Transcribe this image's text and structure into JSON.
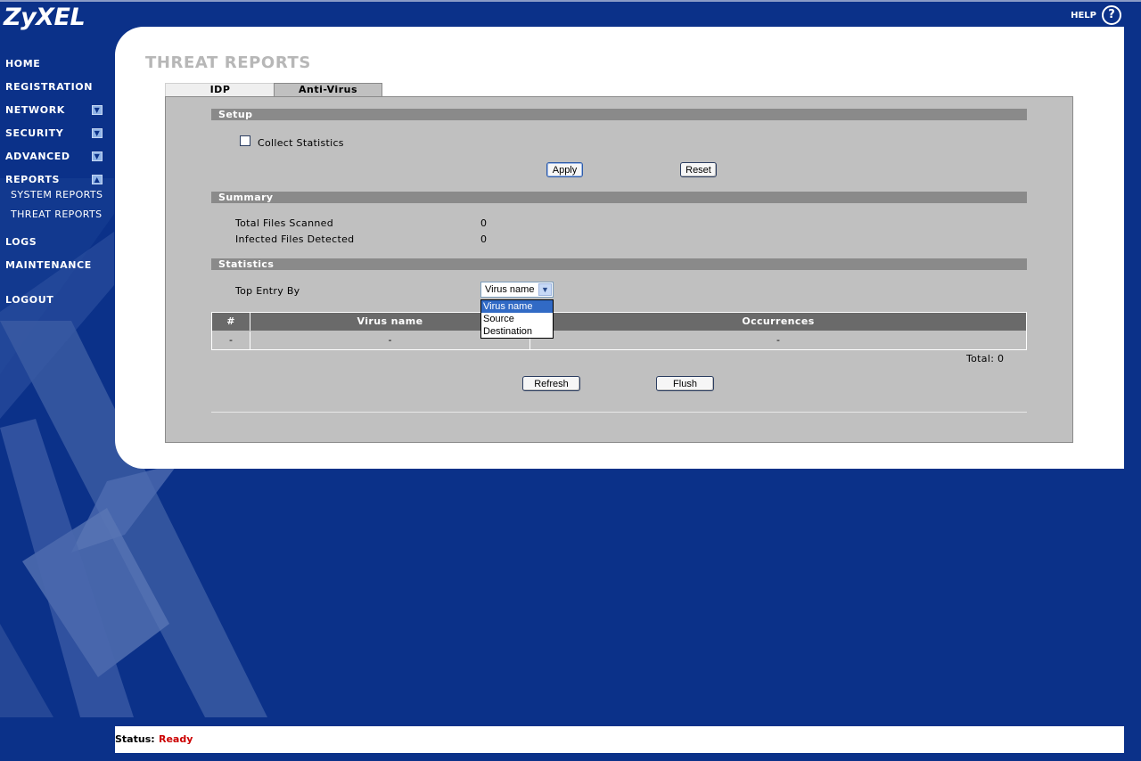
{
  "brand": {
    "logo": "ZyXEL",
    "help_label": "HELP",
    "help_icon_glyph": "?"
  },
  "nav": {
    "items": [
      {
        "label": "HOME"
      },
      {
        "label": "REGISTRATION"
      },
      {
        "label": "NETWORK",
        "expand": "down"
      },
      {
        "label": "SECURITY",
        "expand": "down"
      },
      {
        "label": "ADVANCED",
        "expand": "down"
      },
      {
        "label": "REPORTS",
        "expand": "up"
      },
      {
        "label": "LOGS"
      },
      {
        "label": "MAINTENANCE"
      },
      {
        "label": "LOGOUT"
      }
    ],
    "sub_items": [
      {
        "label": "SYSTEM REPORTS"
      },
      {
        "label": "THREAT REPORTS"
      }
    ]
  },
  "page": {
    "title": "THREAT REPORTS",
    "tabs": [
      {
        "label": "IDP"
      },
      {
        "label": "Anti-Virus",
        "active": true
      }
    ]
  },
  "setup": {
    "section": "Setup",
    "collect_stats_label": "Collect Statistics",
    "collect_stats_checked": false,
    "apply": "Apply",
    "reset": "Reset"
  },
  "summary": {
    "section": "Summary",
    "rows": [
      {
        "label": "Total Files Scanned",
        "value": "0"
      },
      {
        "label": "Infected Files Detected",
        "value": "0"
      }
    ]
  },
  "statistics": {
    "section": "Statistics",
    "top_entry_label": "Top Entry By",
    "top_entry_value": "Virus name",
    "options": [
      "Virus name",
      "Source",
      "Destination"
    ],
    "table": {
      "headers": [
        "#",
        "Virus name",
        "Occurrences"
      ],
      "rows": [
        [
          "-",
          "-",
          "-"
        ]
      ]
    },
    "total_label": "Total: 0",
    "refresh": "Refresh",
    "flush": "Flush"
  },
  "status": {
    "label": "Status:",
    "value": "Ready"
  },
  "colors": {
    "background": "#0b3189",
    "section_bar": "#8a8a8a",
    "content": "#c0c0c0",
    "status_ready": "#cc0000",
    "selected_option": "#316ac5"
  }
}
